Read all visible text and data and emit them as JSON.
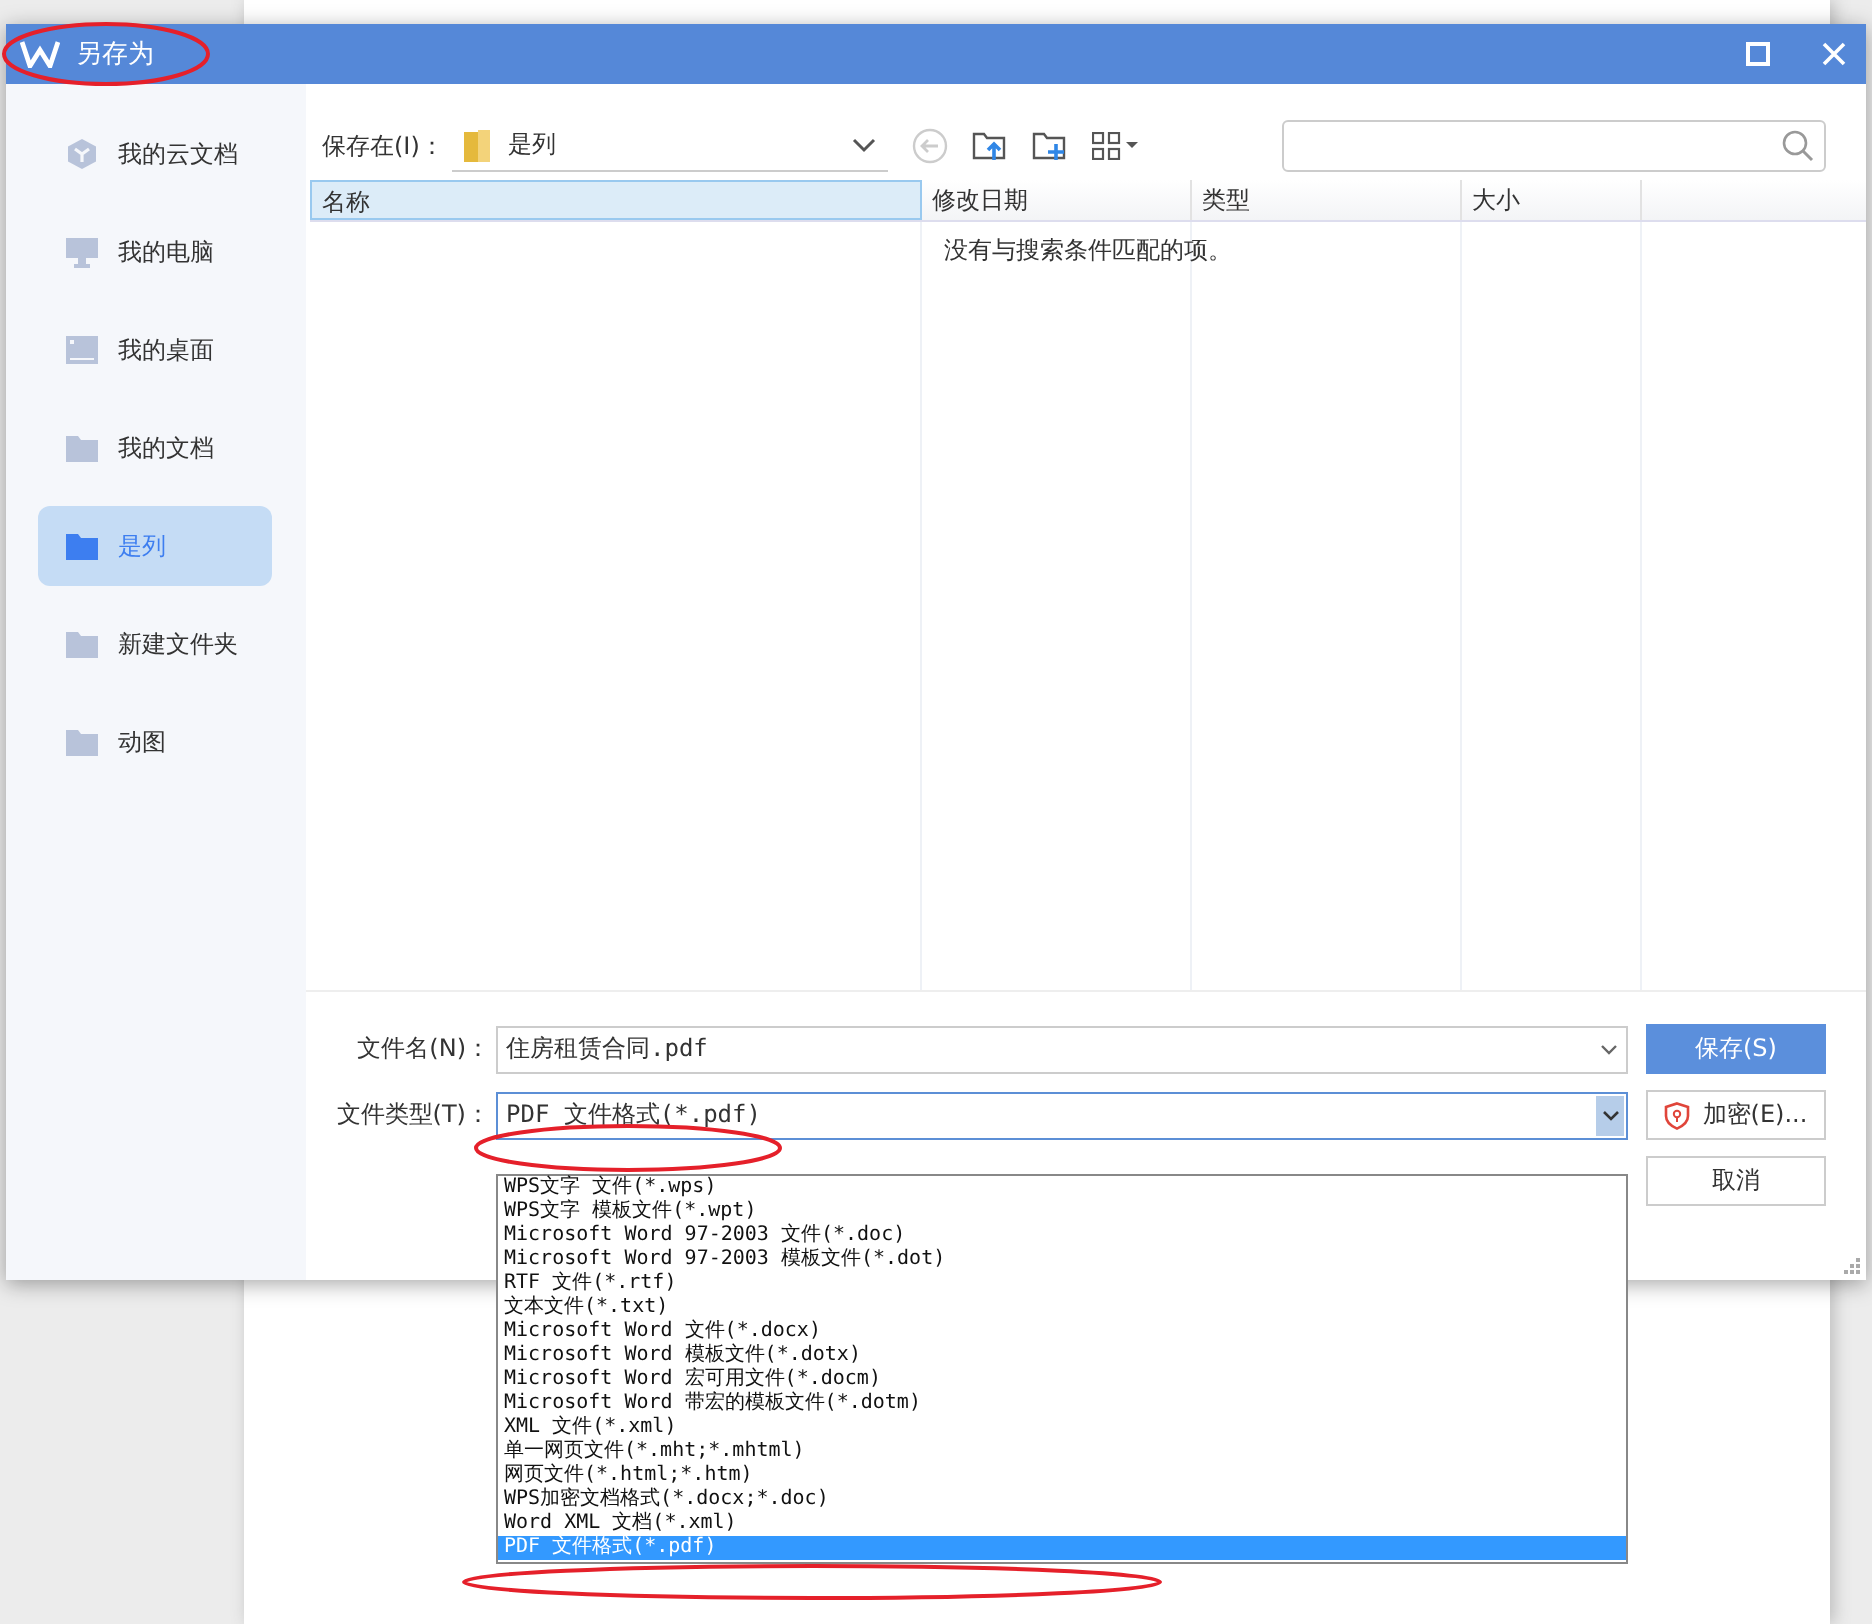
{
  "window": {
    "title": "另存为"
  },
  "sidebar": {
    "items": [
      {
        "label": "我的云文档",
        "kind": "cloud",
        "selected": false
      },
      {
        "label": "我的电脑",
        "kind": "computer",
        "selected": false
      },
      {
        "label": "我的桌面",
        "kind": "desktop",
        "selected": false
      },
      {
        "label": "我的文档",
        "kind": "folder",
        "selected": false
      },
      {
        "label": "是列",
        "kind": "folder",
        "selected": true
      },
      {
        "label": "新建文件夹",
        "kind": "folder",
        "selected": false
      },
      {
        "label": "动图",
        "kind": "folder",
        "selected": false
      }
    ]
  },
  "toolbar": {
    "location_label": "保存在(I)：",
    "location": "是列"
  },
  "table": {
    "columns": [
      "名称",
      "修改日期",
      "类型",
      "大小"
    ],
    "empty_message": "没有与搜索条件匹配的项。"
  },
  "form": {
    "filename_label": "文件名(N)：",
    "filename": "住房租赁合同.pdf",
    "filetype_label": "文件类型(T)：",
    "filetype": "PDF 文件格式(*.pdf)"
  },
  "buttons": [
    {
      "label": "保存(S)",
      "kind": "primary"
    },
    {
      "label": "加密(E)...",
      "kind": "encrypt"
    },
    {
      "label": "取消",
      "kind": "plain"
    }
  ],
  "dropdown": {
    "options": [
      {
        "label": "WPS文字 文件(*.wps)",
        "selected": false
      },
      {
        "label": "WPS文字 模板文件(*.wpt)",
        "selected": false
      },
      {
        "label": "Microsoft Word 97-2003 文件(*.doc)",
        "selected": false
      },
      {
        "label": "Microsoft Word 97-2003 模板文件(*.dot)",
        "selected": false
      },
      {
        "label": "RTF 文件(*.rtf)",
        "selected": false
      },
      {
        "label": "文本文件(*.txt)",
        "selected": false
      },
      {
        "label": "Microsoft Word 文件(*.docx)",
        "selected": false
      },
      {
        "label": "Microsoft Word 模板文件(*.dotx)",
        "selected": false
      },
      {
        "label": "Microsoft Word 宏可用文件(*.docm)",
        "selected": false
      },
      {
        "label": "Microsoft Word 带宏的模板文件(*.dotm)",
        "selected": false
      },
      {
        "label": "XML 文件(*.xml)",
        "selected": false
      },
      {
        "label": "单一网页文件(*.mht;*.mhtml)",
        "selected": false
      },
      {
        "label": "网页文件(*.html;*.htm)",
        "selected": false
      },
      {
        "label": "WPS加密文档格式(*.docx;*.doc)",
        "selected": false
      },
      {
        "label": "Word XML 文档(*.xml)",
        "selected": false
      },
      {
        "label": "PDF 文件格式(*.pdf)",
        "selected": true
      }
    ]
  }
}
